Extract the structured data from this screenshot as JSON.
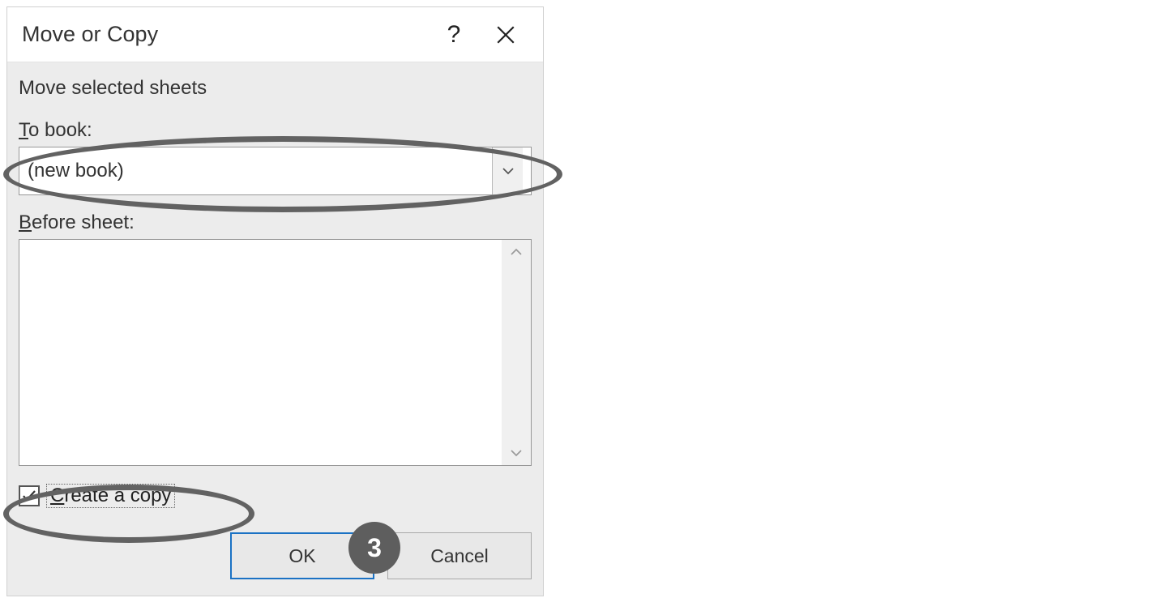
{
  "dialog": {
    "title": "Move or Copy",
    "section_header": "Move selected sheets",
    "to_book_label_pre": "",
    "to_book_underline": "T",
    "to_book_label_post": "o book:",
    "to_book_value": "(new book)",
    "before_sheet_underline": "B",
    "before_sheet_label_post": "efore sheet:",
    "create_copy_underline": "C",
    "create_copy_label_post": "reate a copy",
    "create_copy_checked": true,
    "ok_label": "OK",
    "cancel_label": "Cancel"
  },
  "annotations": {
    "badge_number": "3"
  }
}
